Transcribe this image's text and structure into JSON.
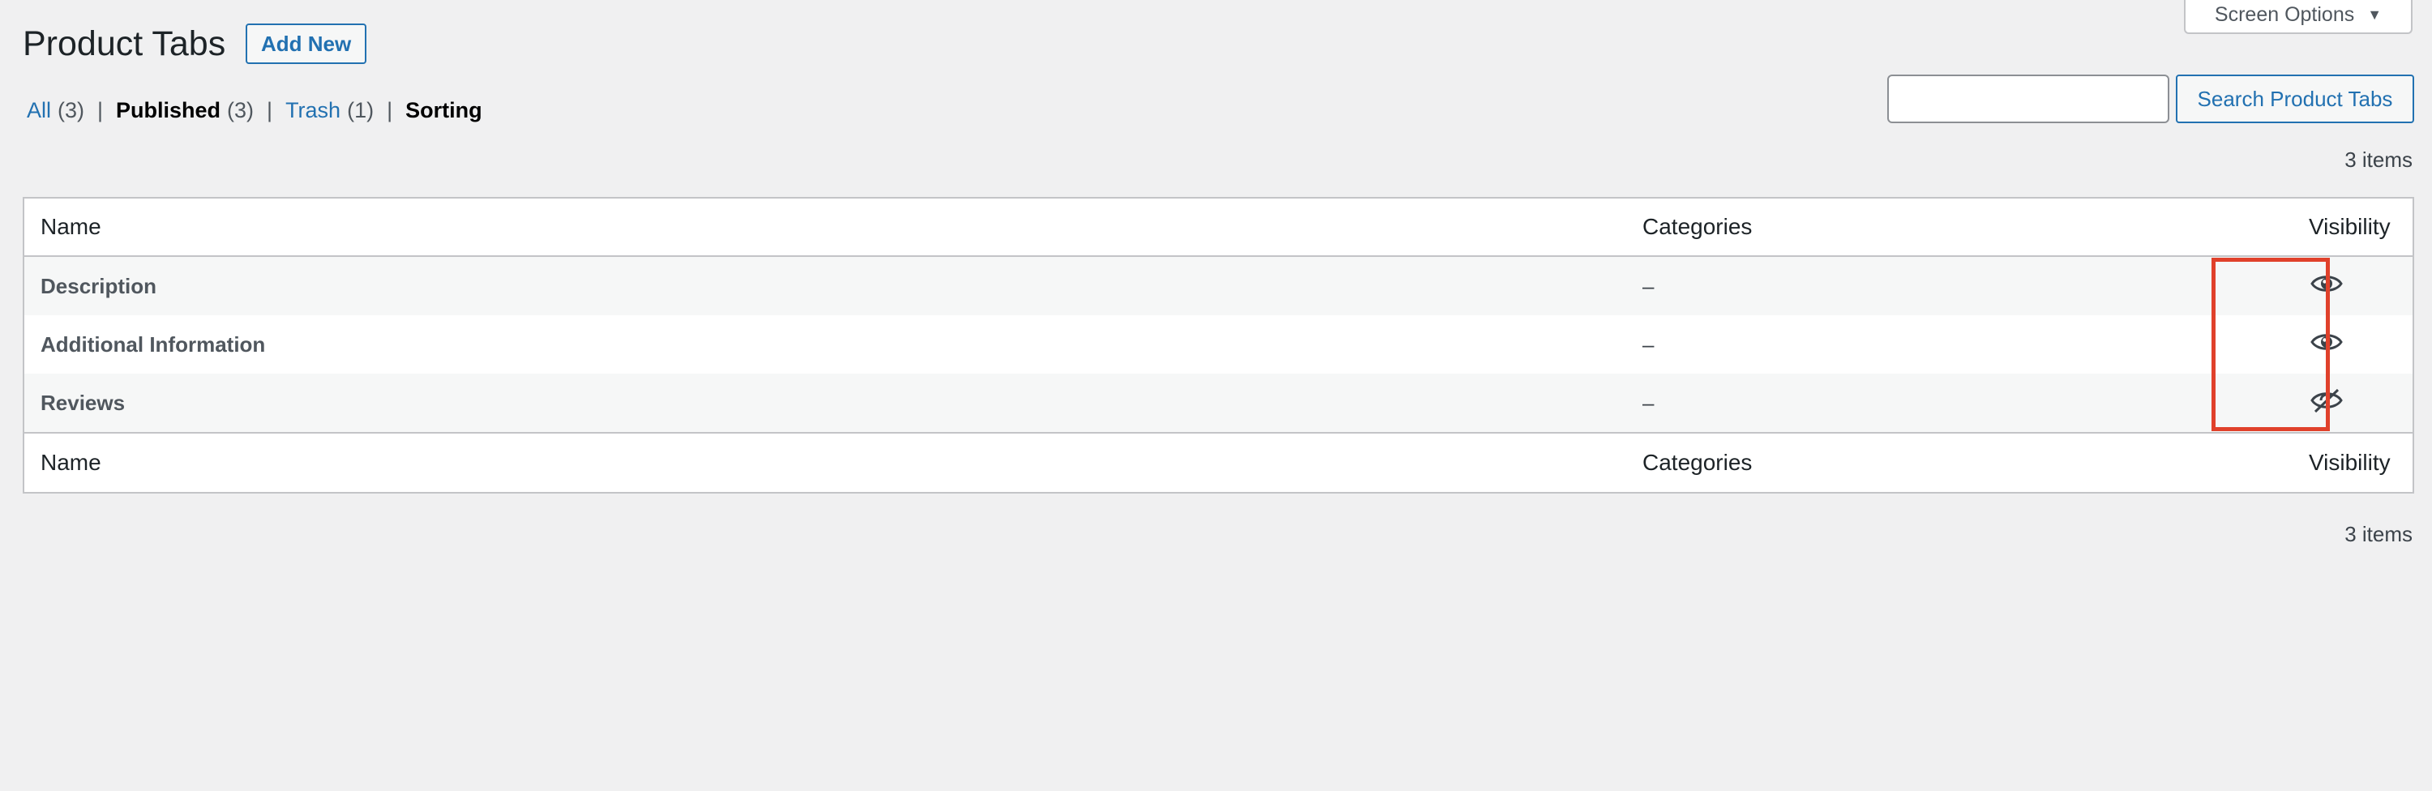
{
  "screen_options": {
    "label": "Screen Options",
    "arrow_icon": "triangle-down-icon"
  },
  "header": {
    "title": "Product Tabs",
    "add_new_label": "Add New"
  },
  "views": [
    {
      "label": "All",
      "count": "(3)",
      "current": false
    },
    {
      "label": "Published",
      "count": "(3)",
      "current": true
    },
    {
      "label": "Trash",
      "count": "(1)",
      "current": false
    },
    {
      "label": "Sorting",
      "count": "",
      "current": true
    }
  ],
  "search": {
    "value": "",
    "placeholder": "",
    "button_label": "Search Product Tabs"
  },
  "items_count": "3 items",
  "table": {
    "columns": [
      "Name",
      "Categories",
      "Visibility"
    ],
    "rows": [
      {
        "name": "Description",
        "categories": "–",
        "visibility": "visible",
        "icon": "eye-icon"
      },
      {
        "name": "Additional Information",
        "categories": "–",
        "visibility": "visible",
        "icon": "eye-icon"
      },
      {
        "name": "Reviews",
        "categories": "–",
        "visibility": "hidden",
        "icon": "eye-slash-icon"
      }
    ]
  },
  "colors": {
    "link": "#2271b1",
    "highlight": "#e0412b",
    "background": "#f0f0f1"
  }
}
